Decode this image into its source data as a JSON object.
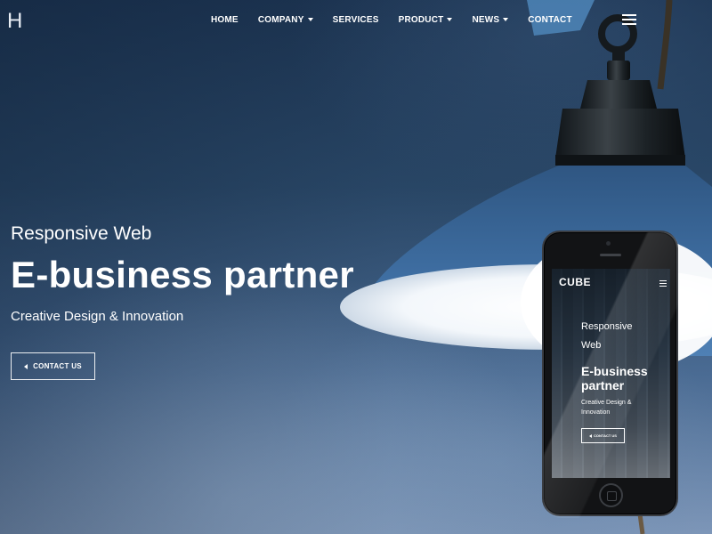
{
  "header": {
    "logo": "H",
    "nav": [
      {
        "label": "HOME",
        "dropdown": false
      },
      {
        "label": "COMPANY",
        "dropdown": true
      },
      {
        "label": "SERVICES",
        "dropdown": false
      },
      {
        "label": "PRODUCT",
        "dropdown": true
      },
      {
        "label": "NEWS",
        "dropdown": true
      },
      {
        "label": "CONTACT",
        "dropdown": false
      }
    ],
    "menu_icon": "hamburger-icon"
  },
  "hero": {
    "subtitle": "Responsive Web",
    "title": "E-business partner",
    "tagline": "Creative Design & Innovation",
    "button_label": "CONTACT US",
    "button_icon": "triangle-left-icon"
  },
  "phone": {
    "logo": "CUBE",
    "menu_icon": "hamburger-icon",
    "subtitle_line1": "Responsive",
    "subtitle_line2": "Web",
    "title_line1": "E-business",
    "title_line2": "partner",
    "tagline_line1": "Creative Design &",
    "tagline_line2": "Innovation",
    "button_label": "CONTACT US"
  },
  "colors": {
    "text": "#ffffff",
    "background": "#2a4566",
    "lamp": "#3d6a9c",
    "lamp_inner": "#eef3f8"
  }
}
